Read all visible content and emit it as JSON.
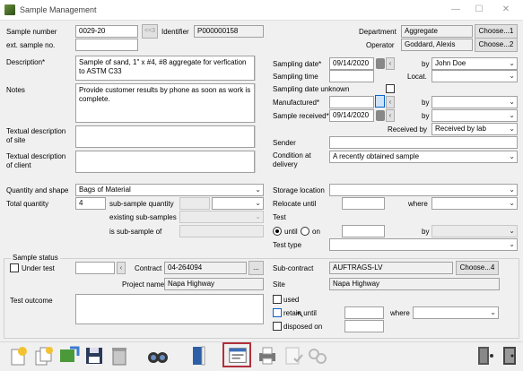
{
  "window": {
    "title": "Sample Management"
  },
  "colors": {
    "accent": "#0a64c8",
    "highlight": "#b0303c"
  },
  "sample": {
    "number_label": "Sample number",
    "number": "0029-20",
    "prev_label": "<<3",
    "identifier_label": "Identifier",
    "identifier": "P000000158",
    "ext_label": "ext. sample no.",
    "ext": "",
    "description_label": "Description*",
    "description": "Sample of sand, 1\" x #4, #8 aggregate for verfication to ASTM C33",
    "notes_label": "Notes",
    "notes": "Provide customer results by phone as soon as work is complete.",
    "text_site_label": "Textual description of site",
    "text_client_label": "Textual description of client",
    "quantity_shape_label": "Quantity and shape",
    "quantity_shape": "Bags of Material",
    "total_qty_label": "Total quantity",
    "total_qty": "4",
    "sub_qty_label": "sub-sample quantity",
    "existing_sub_label": "existing sub-samples",
    "is_sub_label": "is sub-sample of"
  },
  "right": {
    "department_label": "Department",
    "department": "Aggregate",
    "dept_choose": "Choose...1",
    "operator_label": "Operator",
    "operator": "Goddard, Alexis",
    "oper_choose": "Choose...2",
    "sampling_date_label": "Sampling date*",
    "sampling_date": "09/14/2020",
    "by_label": "by",
    "by_value": "John Doe",
    "sampling_time_label": "Sampling time",
    "locat_label": "Locat.",
    "date_unknown_label": "Sampling date unknown",
    "manufactured_label": "Manufactured*",
    "received_label": "Sample received*",
    "received_date": "09/14/2020",
    "received_by_label": "Received by",
    "received_by": "Received by lab",
    "sender_label": "Sender",
    "condition_label": "Condition at delivery",
    "condition": "A recently obtained sample",
    "storage_label": "Storage location",
    "relocate_label": "Relocate until",
    "where_label": "where",
    "test_label": "Test",
    "until_label": "until",
    "on_label": "on",
    "by2_label": "by",
    "test_type_label": "Test type"
  },
  "status": {
    "group_label": "Sample status",
    "under_test_label": "Under test",
    "contract_label": "Contract",
    "contract": "04-264094",
    "project_label": "Project name",
    "project": "Napa Highway",
    "outcome_label": "Test outcome",
    "subcontract_label": "Sub-contract",
    "subcontract": "AUFTRAGS-LV",
    "sub_choose": "Choose...4",
    "site_label": "Site",
    "site": "Napa Highway",
    "used_label": "used",
    "retain_label": "retain until",
    "where_label": "where",
    "disposed_label": "disposed on",
    "ellipsis": "..."
  },
  "toolbar": {
    "icons": [
      "new-sample-icon",
      "copy-sample-icon",
      "image-export-icon",
      "save-icon",
      "delete-icon",
      "search-binoculars-icon",
      "book-icon",
      "report-form-icon",
      "print-icon",
      "document-check-icon",
      "link-icon",
      "exit-door-icon",
      "close-door-icon"
    ]
  }
}
